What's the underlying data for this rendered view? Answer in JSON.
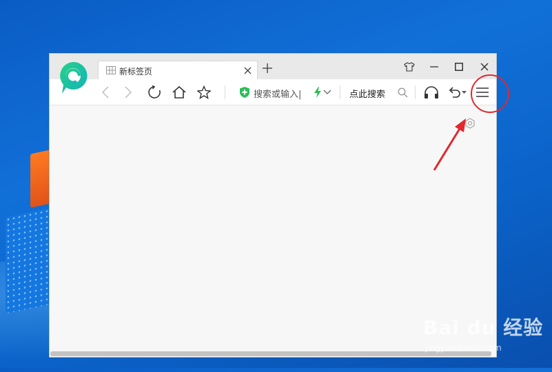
{
  "tab": {
    "title": "新标签页"
  },
  "toolbar": {
    "address_placeholder": "搜索或输入|",
    "search_label": "点此搜索"
  },
  "watermark": {
    "brand": "Bai du 经验",
    "url": "jingyan.baidu.com"
  },
  "colors": {
    "desktop": "#0b63c9",
    "accent_green": "#2ebd59",
    "annotation_red": "#e0282e"
  },
  "icons": {
    "logo": "browser-logo-icon",
    "menu": "hamburger-menu-icon",
    "settings": "gear-icon"
  }
}
